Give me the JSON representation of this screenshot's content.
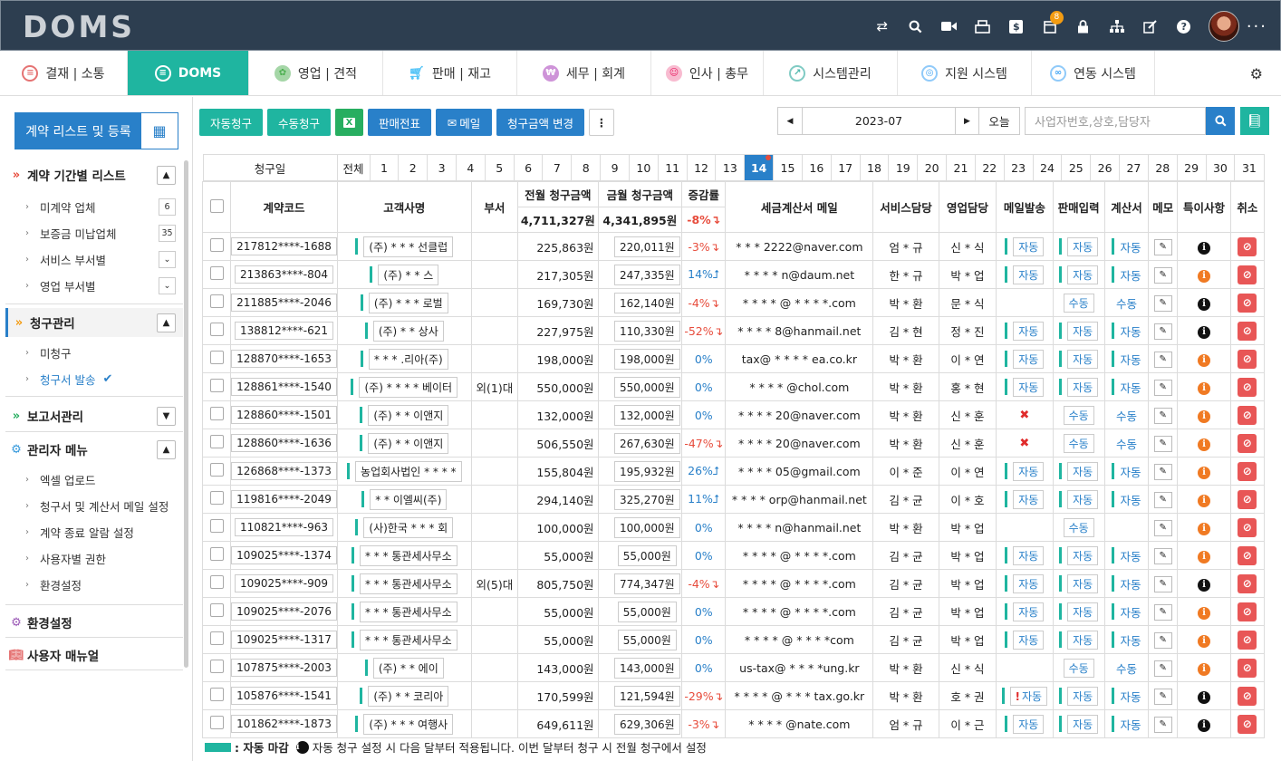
{
  "app": {
    "logo": "DOMS",
    "notif_count": "8",
    "more": "···"
  },
  "colors": {
    "topbar": "#2d3e50",
    "accent": "#1fb5a0",
    "primary": "#2980c9",
    "danger": "#e85656"
  },
  "nav": {
    "tabs": [
      {
        "label": "결재 | 소통"
      },
      {
        "label": "DOMS"
      },
      {
        "label": "영업 | 견적"
      },
      {
        "label": "판매 | 재고"
      },
      {
        "label": "세무 | 회계"
      },
      {
        "label": "인사 | 총무"
      },
      {
        "label": "시스템관리"
      },
      {
        "label": "지원 시스템"
      },
      {
        "label": "연동 시스템"
      }
    ]
  },
  "sidebar": {
    "contract_button": "계약 리스트 및 등록",
    "sec1": "계약 기간별 리스트",
    "sec1_items": [
      {
        "label": "미계약 업체",
        "count": "6"
      },
      {
        "label": "보증금 미납업체",
        "count": "35"
      },
      {
        "label": "서비스 부서별"
      },
      {
        "label": "영업 부서별"
      }
    ],
    "sec2": "청구관리",
    "sec2_items": [
      {
        "label": "미청구"
      },
      {
        "label": "청구서 발송"
      }
    ],
    "sec3": "보고서관리",
    "sec4": "관리자 메뉴",
    "sec4_items": [
      {
        "label": "엑셀 업로드"
      },
      {
        "label": "청구서 및 계산서 메일 설정"
      },
      {
        "label": "계약 종료 알람 설정"
      },
      {
        "label": "사용자별 권한"
      },
      {
        "label": "환경설정"
      }
    ],
    "sec5": "환경설정",
    "sec6": "사용자 매뉴얼"
  },
  "toolbar": {
    "auto_bill": "자동청구",
    "manual_bill": "수동청구",
    "excel": "X",
    "sales_slip": "판매전표",
    "mail": "메일",
    "change_amount": "청구금액 변경",
    "more": "⋮",
    "month": "2023-07",
    "today": "오늘",
    "search_placeholder": "사업자번호,상호,담당자"
  },
  "days_row": {
    "label": "청구일",
    "all": "전체",
    "days": [
      "1",
      "2",
      "3",
      "4",
      "5",
      "6",
      "7",
      "8",
      "9",
      "10",
      "11",
      "12",
      "13",
      "14",
      "15",
      "16",
      "17",
      "18",
      "19",
      "20",
      "21",
      "22",
      "23",
      "24",
      "25",
      "26",
      "27",
      "28",
      "29",
      "30",
      "31"
    ]
  },
  "table": {
    "headers": {
      "code": "계약코드",
      "customer": "고객사명",
      "dept": "부서",
      "prev": "전월 청구금액",
      "cur": "금월 청구금액",
      "change": "증감률",
      "email": "세금계산서 메일",
      "svc": "서비스담당",
      "sales": "영업담당",
      "mail": "메일발송",
      "sale_input": "판매입력",
      "invoice": "계산서",
      "memo": "메모",
      "special": "특이사항",
      "cancel": "취소"
    },
    "prev_total": "4,711,327원",
    "cur_total": "4,341,895원",
    "change_total": "-8%↴",
    "rows": [
      {
        "code": "217812****-1688",
        "customer": "(주) * * * 선클럽",
        "dept": "",
        "prev": "225,863원",
        "cur": "220,011원",
        "change": "-3%↴",
        "email": "* * * 2222@naver.com",
        "svc": "엄 * 규",
        "sales": "신 * 식",
        "mail": "자동",
        "sale": "자동",
        "inv": "자동",
        "special": "black"
      },
      {
        "code": "213863****-804",
        "customer": "(주) * * 스",
        "dept": "",
        "prev": "217,305원",
        "cur": "247,335원",
        "change": "14%⮥",
        "email": "* * * * n@daum.net",
        "svc": "한 * 규",
        "sales": "박 * 업",
        "mail": "자동",
        "sale": "자동",
        "inv": "자동",
        "special": "orange"
      },
      {
        "code": "211885****-2046",
        "customer": "(주) * * * 로벌",
        "dept": "",
        "prev": "169,730원",
        "cur": "162,140원",
        "change": "-4%↴",
        "email": "* * * * @ * * * *.com",
        "svc": "박 * 환",
        "sales": "문 * 식",
        "mail": "",
        "sale": "수동",
        "inv": "수동",
        "special": "black"
      },
      {
        "code": "138812****-621",
        "customer": "(주) * * 상사",
        "dept": "",
        "prev": "227,975원",
        "cur": "110,330원",
        "change": "-52%↴",
        "email": "* * * * 8@hanmail.net",
        "svc": "김 * 현",
        "sales": "정 * 진",
        "mail": "자동",
        "sale": "자동",
        "inv": "자동",
        "special": "black"
      },
      {
        "code": "128870****-1653",
        "customer": "* * * .리아(주)",
        "dept": "",
        "prev": "198,000원",
        "cur": "198,000원",
        "change": "0%",
        "email": "tax@ * * * * ea.co.kr",
        "svc": "박 * 환",
        "sales": "이 * 연",
        "mail": "자동",
        "sale": "자동",
        "inv": "자동",
        "special": "orange"
      },
      {
        "code": "128861****-1540",
        "customer": "(주) * * * * 베이터",
        "dept": "외(1)대",
        "prev": "550,000원",
        "cur": "550,000원",
        "change": "0%",
        "email": "* * * *  @chol.com",
        "svc": "박 * 환",
        "sales": "홍 * 현",
        "mail": "자동",
        "sale": "자동",
        "inv": "자동",
        "special": "orange"
      },
      {
        "code": "128860****-1501",
        "customer": "(주) * * 이앤지",
        "dept": "",
        "prev": "132,000원",
        "cur": "132,000원",
        "change": "0%",
        "email": "* * * * 20@naver.com",
        "svc": "박 * 환",
        "sales": "신 * 훈",
        "mail": "x",
        "sale": "수동",
        "inv": "수동",
        "special": "orange"
      },
      {
        "code": "128860****-1636",
        "customer": "(주) * * 이앤지",
        "dept": "",
        "prev": "506,550원",
        "cur": "267,630원",
        "change": "-47%↴",
        "email": "* * * * 20@naver.com",
        "svc": "박 * 환",
        "sales": "신 * 훈",
        "mail": "x",
        "sale": "수동",
        "inv": "수동",
        "special": "orange"
      },
      {
        "code": "126868****-1373",
        "customer": "농업회사법인 * * * *",
        "dept": "",
        "prev": "155,804원",
        "cur": "195,932원",
        "change": "26%⮥",
        "email": "* * * * 05@gmail.com",
        "svc": "이 * 준",
        "sales": "이 * 연",
        "mail": "자동",
        "sale": "자동",
        "inv": "자동",
        "special": "orange"
      },
      {
        "code": "119816****-2049",
        "customer": "* * 이엘씨(주)",
        "dept": "",
        "prev": "294,140원",
        "cur": "325,270원",
        "change": "11%⮥",
        "email": "* * * * orp@hanmail.net",
        "svc": "김 * 균",
        "sales": "이 * 호",
        "mail": "자동",
        "sale": "자동",
        "inv": "자동",
        "special": "orange"
      },
      {
        "code": "110821****-963",
        "customer": "(사)한국 * * * 회",
        "dept": "",
        "prev": "100,000원",
        "cur": "100,000원",
        "change": "0%",
        "email": "* * * * n@hanmail.net",
        "svc": "박 * 환",
        "sales": "박 * 업",
        "mail": "",
        "sale": "수동",
        "inv": "",
        "special": "orange"
      },
      {
        "code": "109025****-1374",
        "customer": "* * * 통관세사무소",
        "dept": "",
        "prev": "55,000원",
        "cur": "55,000원",
        "change": "0%",
        "email": "* * * * @ * * * *.com",
        "svc": "김 * 균",
        "sales": "박 * 업",
        "mail": "자동",
        "sale": "자동",
        "inv": "자동",
        "special": "orange"
      },
      {
        "code": "109025****-909",
        "customer": "* * * 통관세사무소",
        "dept": "외(5)대",
        "prev": "805,750원",
        "cur": "774,347원",
        "change": "-4%↴",
        "email": "* * * * @ * * * *.com",
        "svc": "김 * 균",
        "sales": "박 * 업",
        "mail": "자동",
        "sale": "자동",
        "inv": "자동",
        "special": "black"
      },
      {
        "code": "109025****-2076",
        "customer": "* * * 통관세사무소",
        "dept": "",
        "prev": "55,000원",
        "cur": "55,000원",
        "change": "0%",
        "email": "* * * * @ * * * *.com",
        "svc": "김 * 균",
        "sales": "박 * 업",
        "mail": "자동",
        "sale": "자동",
        "inv": "자동",
        "special": "orange"
      },
      {
        "code": "109025****-1317",
        "customer": "* * * 통관세사무소",
        "dept": "",
        "prev": "55,000원",
        "cur": "55,000원",
        "change": "0%",
        "email": "* * * * @ * * * *com",
        "svc": "김 * 균",
        "sales": "박 * 업",
        "mail": "자동",
        "sale": "자동",
        "inv": "자동",
        "special": "orange"
      },
      {
        "code": "107875****-2003",
        "customer": "(주) * * 에이",
        "dept": "",
        "prev": "143,000원",
        "cur": "143,000원",
        "change": "0%",
        "email": "us-tax@  * * * *ung.kr",
        "svc": "박 * 환",
        "sales": "신 * 식",
        "mail": "",
        "sale": "수동",
        "inv": "수동",
        "special": "orange"
      },
      {
        "code": "105876****-1541",
        "customer": "(주) * * 코리아",
        "dept": "",
        "prev": "170,599원",
        "cur": "121,594원",
        "change": "-29%↴",
        "email": "* * * * @ * * * tax.go.kr",
        "svc": "박 * 환",
        "sales": "호 * 권",
        "mail": "!자동",
        "sale": "자동",
        "inv": "자동",
        "special": "black"
      },
      {
        "code": "101862****-1873",
        "customer": "(주) * * * 여행사",
        "dept": "",
        "prev": "649,611원",
        "cur": "629,306원",
        "change": "-3%↴",
        "email": "* * * *  @nate.com",
        "svc": "엄 * 규",
        "sales": "이 * 근",
        "mail": "자동",
        "sale": "자동",
        "inv": "자동",
        "special": "black"
      }
    ]
  },
  "legend": {
    "label": ": 자동 마감",
    "note": "자동 청구 설정 시 다음 달부터 적용됩니다. 이번 달부터 청구 시 전월 청구에서 설정"
  }
}
